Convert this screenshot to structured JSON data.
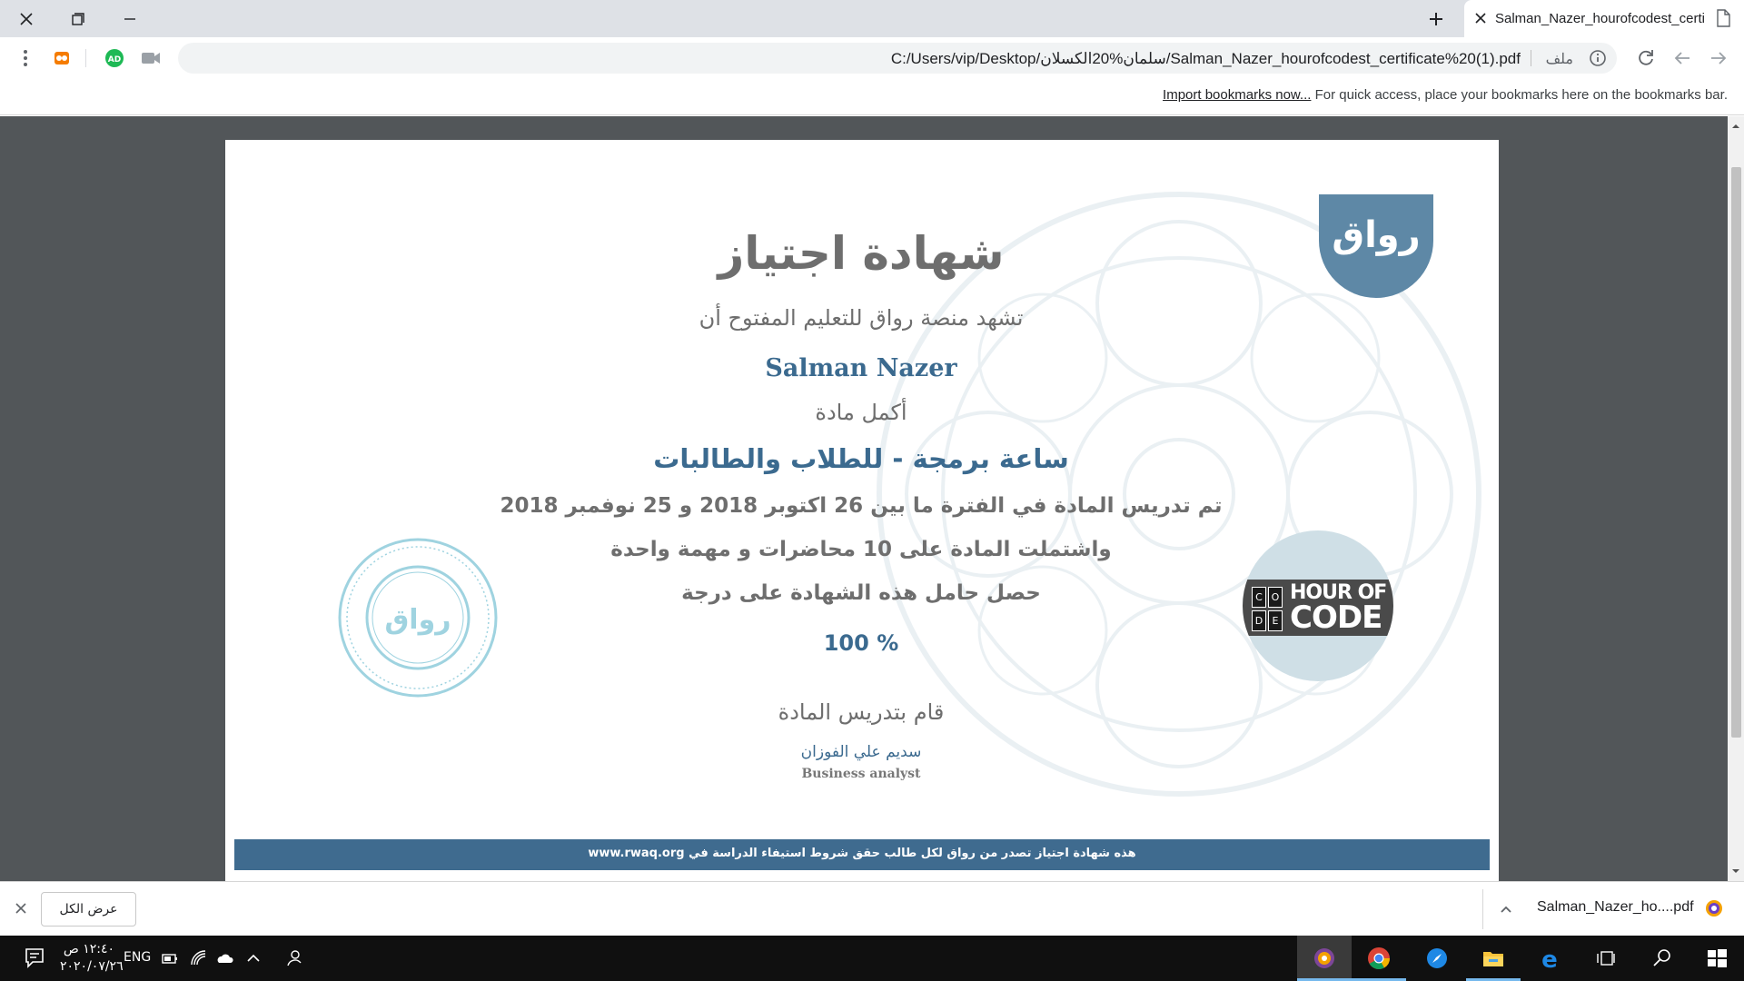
{
  "browser": {
    "tab": {
      "title": "Salman_Nazer_hourofcodest_certi"
    },
    "omnibox": {
      "scheme_label": "ملف",
      "url": "C:/Users/vip/Desktop/سلمان%20الكسلان/Salman_Nazer_hourofcodest_certificate%20(1).pdf"
    },
    "bookmarks_bar": {
      "import_link": "Import bookmarks now...",
      "hint": "For quick access, place your bookmarks here on the bookmarks bar."
    }
  },
  "certificate": {
    "logo_text": "رواق",
    "title": "شهادة اجتياز",
    "subtitle": "تشهد منصة رواق للتعليم المفتوح أن",
    "student_name": "Salman Nazer",
    "completed_label": "أكمل مادة",
    "course_name": "ساعة برمجة - للطلاب والطالبات",
    "period": "تم تدريس المادة في الفترة ما بين 26 اكتوبر 2018 و 25 نوفمبر 2018",
    "contents": "واشتملت المادة على 10 محاضرات و مهمة واحدة",
    "grade_label": "حصل حامل هذه الشهادة على درجة",
    "grade": "% 100",
    "taught_by_label": "قام بتدريس المادة",
    "instructor_name": "سديم علي الفوزان",
    "instructor_role": "Business analyst",
    "seal_text": "رواق",
    "hoc_logo": {
      "line1": "HOUR OF",
      "line2": "CODE",
      "cells": [
        "C",
        "O",
        "D",
        "E"
      ]
    },
    "footer": "هذه شهادة اجتياز تصدر من رواق لكل طالب حقق شروط استيفاء الدراسة في www.rwaq.org"
  },
  "downloads": {
    "show_all": "عرض الكل",
    "file_name": "Salman_Nazer_ho....pdf"
  },
  "taskbar": {
    "time": "١٢:٤٠ ص",
    "date": "٢٠٢٠/٠٧/٢٦",
    "language": "ENG"
  },
  "colors": {
    "accent_blue": "#3b6a8f",
    "footer_band": "#3f6b8f",
    "logo_badge": "#5e88a6",
    "viewer_bg": "#525659",
    "taskbar_bg": "#101010"
  }
}
